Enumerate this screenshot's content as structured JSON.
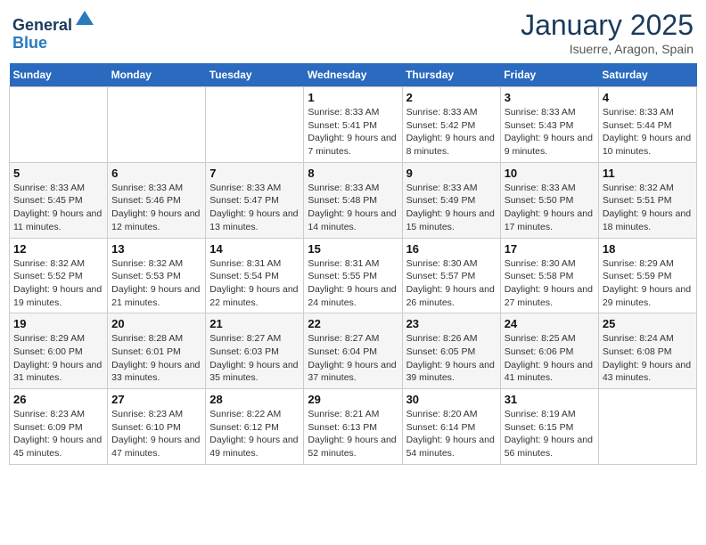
{
  "header": {
    "logo_general": "General",
    "logo_blue": "Blue",
    "month_title": "January 2025",
    "location": "Isuerre, Aragon, Spain"
  },
  "weekdays": [
    "Sunday",
    "Monday",
    "Tuesday",
    "Wednesday",
    "Thursday",
    "Friday",
    "Saturday"
  ],
  "weeks": [
    [
      {
        "day": "",
        "info": ""
      },
      {
        "day": "",
        "info": ""
      },
      {
        "day": "",
        "info": ""
      },
      {
        "day": "1",
        "info": "Sunrise: 8:33 AM\nSunset: 5:41 PM\nDaylight: 9 hours and 7 minutes."
      },
      {
        "day": "2",
        "info": "Sunrise: 8:33 AM\nSunset: 5:42 PM\nDaylight: 9 hours and 8 minutes."
      },
      {
        "day": "3",
        "info": "Sunrise: 8:33 AM\nSunset: 5:43 PM\nDaylight: 9 hours and 9 minutes."
      },
      {
        "day": "4",
        "info": "Sunrise: 8:33 AM\nSunset: 5:44 PM\nDaylight: 9 hours and 10 minutes."
      }
    ],
    [
      {
        "day": "5",
        "info": "Sunrise: 8:33 AM\nSunset: 5:45 PM\nDaylight: 9 hours and 11 minutes."
      },
      {
        "day": "6",
        "info": "Sunrise: 8:33 AM\nSunset: 5:46 PM\nDaylight: 9 hours and 12 minutes."
      },
      {
        "day": "7",
        "info": "Sunrise: 8:33 AM\nSunset: 5:47 PM\nDaylight: 9 hours and 13 minutes."
      },
      {
        "day": "8",
        "info": "Sunrise: 8:33 AM\nSunset: 5:48 PM\nDaylight: 9 hours and 14 minutes."
      },
      {
        "day": "9",
        "info": "Sunrise: 8:33 AM\nSunset: 5:49 PM\nDaylight: 9 hours and 15 minutes."
      },
      {
        "day": "10",
        "info": "Sunrise: 8:33 AM\nSunset: 5:50 PM\nDaylight: 9 hours and 17 minutes."
      },
      {
        "day": "11",
        "info": "Sunrise: 8:32 AM\nSunset: 5:51 PM\nDaylight: 9 hours and 18 minutes."
      }
    ],
    [
      {
        "day": "12",
        "info": "Sunrise: 8:32 AM\nSunset: 5:52 PM\nDaylight: 9 hours and 19 minutes."
      },
      {
        "day": "13",
        "info": "Sunrise: 8:32 AM\nSunset: 5:53 PM\nDaylight: 9 hours and 21 minutes."
      },
      {
        "day": "14",
        "info": "Sunrise: 8:31 AM\nSunset: 5:54 PM\nDaylight: 9 hours and 22 minutes."
      },
      {
        "day": "15",
        "info": "Sunrise: 8:31 AM\nSunset: 5:55 PM\nDaylight: 9 hours and 24 minutes."
      },
      {
        "day": "16",
        "info": "Sunrise: 8:30 AM\nSunset: 5:57 PM\nDaylight: 9 hours and 26 minutes."
      },
      {
        "day": "17",
        "info": "Sunrise: 8:30 AM\nSunset: 5:58 PM\nDaylight: 9 hours and 27 minutes."
      },
      {
        "day": "18",
        "info": "Sunrise: 8:29 AM\nSunset: 5:59 PM\nDaylight: 9 hours and 29 minutes."
      }
    ],
    [
      {
        "day": "19",
        "info": "Sunrise: 8:29 AM\nSunset: 6:00 PM\nDaylight: 9 hours and 31 minutes."
      },
      {
        "day": "20",
        "info": "Sunrise: 8:28 AM\nSunset: 6:01 PM\nDaylight: 9 hours and 33 minutes."
      },
      {
        "day": "21",
        "info": "Sunrise: 8:27 AM\nSunset: 6:03 PM\nDaylight: 9 hours and 35 minutes."
      },
      {
        "day": "22",
        "info": "Sunrise: 8:27 AM\nSunset: 6:04 PM\nDaylight: 9 hours and 37 minutes."
      },
      {
        "day": "23",
        "info": "Sunrise: 8:26 AM\nSunset: 6:05 PM\nDaylight: 9 hours and 39 minutes."
      },
      {
        "day": "24",
        "info": "Sunrise: 8:25 AM\nSunset: 6:06 PM\nDaylight: 9 hours and 41 minutes."
      },
      {
        "day": "25",
        "info": "Sunrise: 8:24 AM\nSunset: 6:08 PM\nDaylight: 9 hours and 43 minutes."
      }
    ],
    [
      {
        "day": "26",
        "info": "Sunrise: 8:23 AM\nSunset: 6:09 PM\nDaylight: 9 hours and 45 minutes."
      },
      {
        "day": "27",
        "info": "Sunrise: 8:23 AM\nSunset: 6:10 PM\nDaylight: 9 hours and 47 minutes."
      },
      {
        "day": "28",
        "info": "Sunrise: 8:22 AM\nSunset: 6:12 PM\nDaylight: 9 hours and 49 minutes."
      },
      {
        "day": "29",
        "info": "Sunrise: 8:21 AM\nSunset: 6:13 PM\nDaylight: 9 hours and 52 minutes."
      },
      {
        "day": "30",
        "info": "Sunrise: 8:20 AM\nSunset: 6:14 PM\nDaylight: 9 hours and 54 minutes."
      },
      {
        "day": "31",
        "info": "Sunrise: 8:19 AM\nSunset: 6:15 PM\nDaylight: 9 hours and 56 minutes."
      },
      {
        "day": "",
        "info": ""
      }
    ]
  ]
}
